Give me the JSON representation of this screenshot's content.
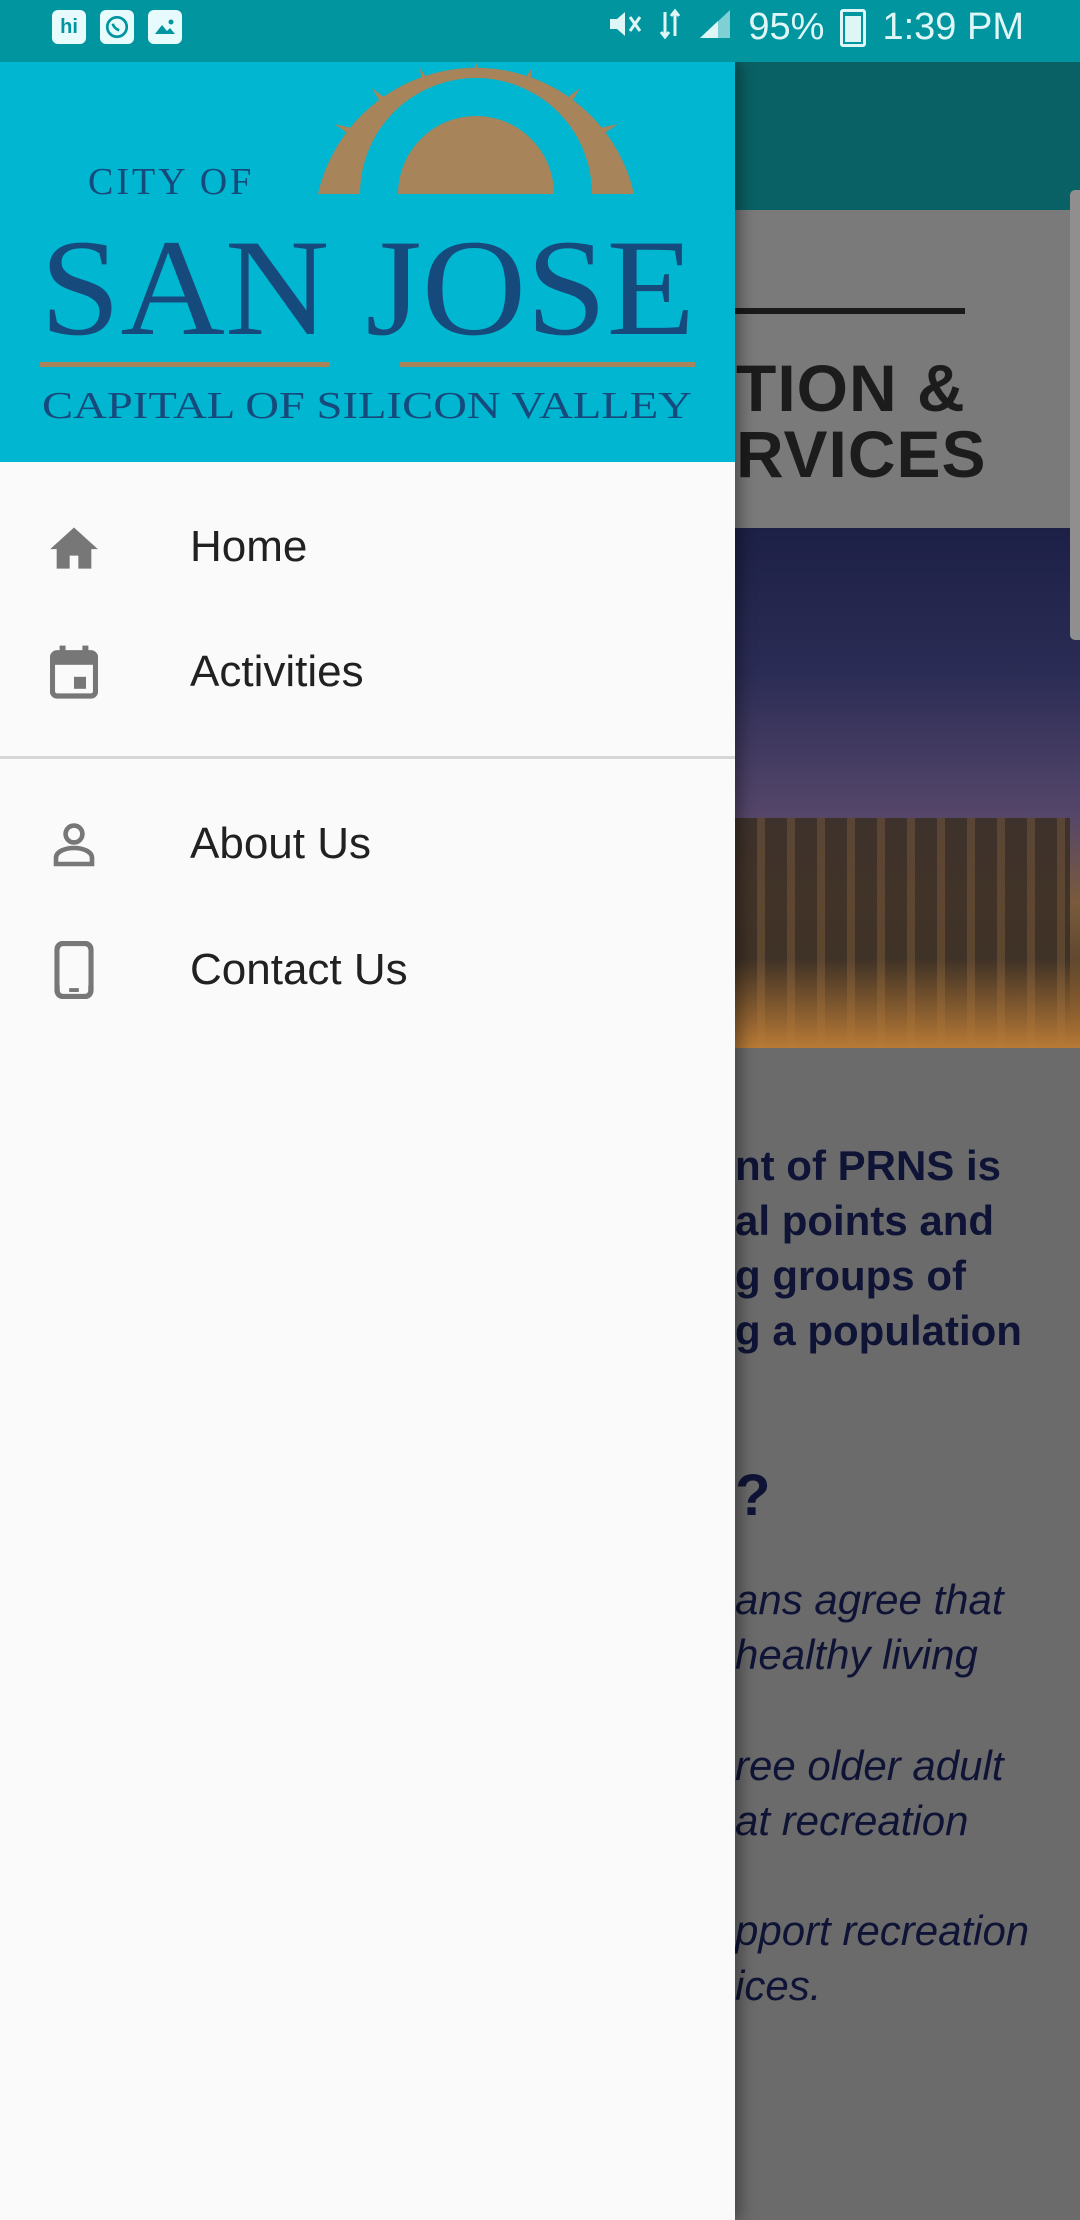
{
  "status_bar": {
    "battery": "95%",
    "time": "1:39 PM",
    "left_icons": [
      "hi-messenger-icon",
      "whatsapp-icon",
      "gallery-icon"
    ],
    "right_icons": [
      "mute-icon",
      "data-icon",
      "signal-icon",
      "battery-icon"
    ]
  },
  "drawer": {
    "logo": {
      "line1": "CITY OF",
      "line2": "SAN JOSE",
      "line3": "CAPITAL OF SILICON VALLEY"
    },
    "items": [
      {
        "label": "Home",
        "icon": "home-icon"
      },
      {
        "label": "Activities",
        "icon": "calendar-icon"
      },
      {
        "label": "About Us",
        "icon": "person-icon"
      },
      {
        "label": "Contact Us",
        "icon": "phone-icon"
      }
    ]
  },
  "background_page": {
    "title_line1": "TION &",
    "title_line2": "RVICES",
    "para1": [
      "nt of PRNS is",
      "al points and",
      "g groups of",
      "g a population"
    ],
    "question": "?",
    "para2": [
      "ans agree that",
      "healthy living"
    ],
    "para3": [
      "ree older adult",
      "at recreation"
    ],
    "para4": [
      "pport recreation",
      "ices."
    ]
  },
  "colors": {
    "status_bar": "#00959f",
    "drawer_header": "#00b6d0",
    "logo_navy": "#174a7c",
    "logo_sun": "#a8845a"
  }
}
